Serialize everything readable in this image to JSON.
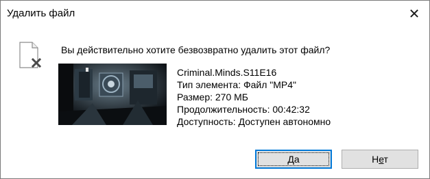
{
  "window": {
    "title": "Удалить файл",
    "close_glyph": "✕"
  },
  "message": {
    "question": "Вы действительно хотите безвозвратно удалить этот файл?"
  },
  "file": {
    "icon": "file-delete-icon",
    "name": "Criminal.Minds.S11E16",
    "type": "Тип элемента: Файл \"MP4\"",
    "size": "Размер: 270 МБ",
    "duration": "Продолжительность: 00:42:32",
    "availability": "Доступность: Доступен автономно"
  },
  "buttons": {
    "yes": {
      "pre": "",
      "accel": "Д",
      "post": "а"
    },
    "no": {
      "pre": "Н",
      "accel": "е",
      "post": "т"
    }
  },
  "colors": {
    "focus_border": "#0078d7",
    "button_bg": "#e1e1e1"
  }
}
